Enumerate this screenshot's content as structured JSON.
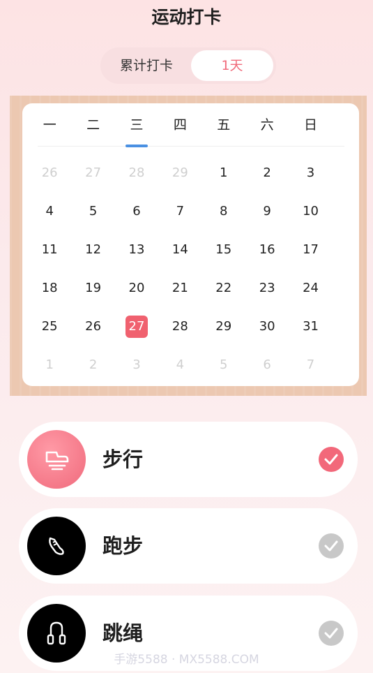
{
  "header": {
    "title": "运动打卡"
  },
  "counter": {
    "label": "累计打卡",
    "value": "1天"
  },
  "calendar": {
    "weekdays": [
      "一",
      "二",
      "三",
      "四",
      "五",
      "六",
      "日"
    ],
    "selected_weekday_index": 2,
    "rows": [
      [
        {
          "d": "26",
          "muted": true
        },
        {
          "d": "27",
          "muted": true
        },
        {
          "d": "28",
          "muted": true
        },
        {
          "d": "29",
          "muted": true
        },
        {
          "d": "1"
        },
        {
          "d": "2"
        },
        {
          "d": "3"
        }
      ],
      [
        {
          "d": "4"
        },
        {
          "d": "5"
        },
        {
          "d": "6"
        },
        {
          "d": "7"
        },
        {
          "d": "8"
        },
        {
          "d": "9"
        },
        {
          "d": "10"
        }
      ],
      [
        {
          "d": "11"
        },
        {
          "d": "12"
        },
        {
          "d": "13"
        },
        {
          "d": "14"
        },
        {
          "d": "15"
        },
        {
          "d": "16"
        },
        {
          "d": "17"
        }
      ],
      [
        {
          "d": "18"
        },
        {
          "d": "19"
        },
        {
          "d": "20"
        },
        {
          "d": "21"
        },
        {
          "d": "22"
        },
        {
          "d": "23"
        },
        {
          "d": "24"
        }
      ],
      [
        {
          "d": "25"
        },
        {
          "d": "26"
        },
        {
          "d": "27",
          "today": true
        },
        {
          "d": "28"
        },
        {
          "d": "29"
        },
        {
          "d": "30"
        },
        {
          "d": "31"
        }
      ],
      [
        {
          "d": "1",
          "muted": true
        },
        {
          "d": "2",
          "muted": true
        },
        {
          "d": "3",
          "muted": true
        },
        {
          "d": "4",
          "muted": true
        },
        {
          "d": "5",
          "muted": true
        },
        {
          "d": "6",
          "muted": true
        },
        {
          "d": "7",
          "muted": true
        }
      ]
    ]
  },
  "activities": [
    {
      "label": "步行",
      "icon": "shoe-walk-icon",
      "checked": true
    },
    {
      "label": "跑步",
      "icon": "running-shoe-icon",
      "checked": false
    },
    {
      "label": "跳绳",
      "icon": "jump-rope-icon",
      "checked": false
    }
  ],
  "colors": {
    "accent": "#f0616f",
    "check_active": "#f2687a",
    "check_inactive": "#c8c8c8",
    "dark_circle": "#000000"
  },
  "watermark": "手游5588 · MX5588.COM"
}
